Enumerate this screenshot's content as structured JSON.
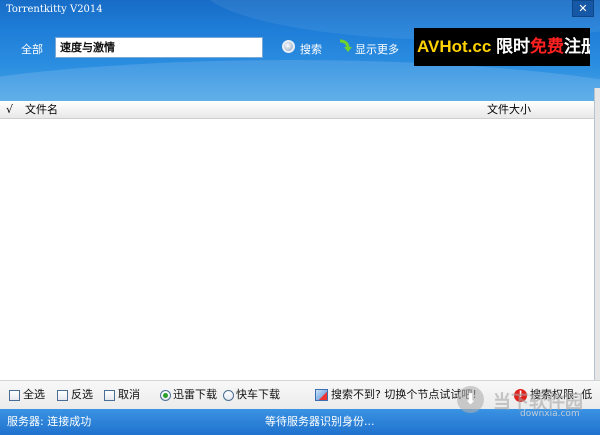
{
  "window": {
    "title": "Torrentkitty V2014",
    "close_glyph": "✕"
  },
  "search": {
    "scope_label": "全部",
    "query": "速度与激情",
    "search_label": "搜索",
    "more_label": "显示更多"
  },
  "ad": {
    "brand": "AVHot.cc",
    "text_limited": "限时",
    "text_free": "免费",
    "text_register": "注册!"
  },
  "table": {
    "columns": [
      "√",
      "文件名",
      "文件大小"
    ],
    "rows": []
  },
  "toolbar": {
    "select_all": "全选",
    "invert_selection": "反选",
    "cancel": "取消",
    "download_modes": [
      {
        "label": "迅雷下载",
        "selected": true
      },
      {
        "label": "快车下载",
        "selected": false
      }
    ],
    "hint": "搜索不到? 切换个节点试试吧!",
    "permission": "搜索权限: 低"
  },
  "status": {
    "server": "服务器: 连接成功",
    "message": "等待服务器识别身份..."
  },
  "watermark": {
    "name": "当下软件园",
    "domain": "downxia.com"
  },
  "icons": {
    "close": "close-icon",
    "search": "search-icon",
    "more": "show-more-icon",
    "hint": "node-switch-icon",
    "permission": "warning-icon",
    "watermark": "download-arrow-icon"
  },
  "colors": {
    "header": "#2486dd",
    "status_bar": "#2a7fd6",
    "ad_brand": "#ffd200",
    "ad_free": "#ff2020",
    "radio_checked": "#2aa02a",
    "warning": "#e0201b"
  }
}
